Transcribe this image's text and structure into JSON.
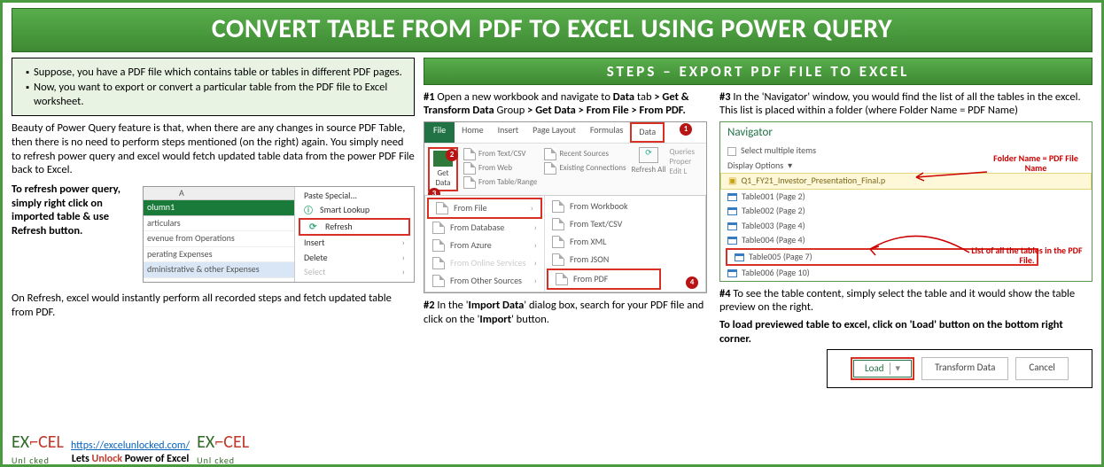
{
  "title": "CONVERT TABLE FROM PDF TO EXCEL USING POWER QUERY",
  "steps_header": "STEPS – EXPORT PDF FILE TO EXCEL",
  "intro_bullets": [
    "Suppose, you have a PDF file which contains table or tables in different PDF pages.",
    "Now, you want to export or convert a particular table from the PDF file to Excel worksheet."
  ],
  "beauty_para": "Beauty of Power Query feature is that, when there are any changes in source PDF Table, then there is no need to perform steps mentioned (on the right) again. You simply need to refresh power query and excel would fetch updated table data from the power PDF File back to Excel.",
  "refresh_hint": "To refresh power query, simply right click on imported table & use Refresh button.",
  "on_refresh": "On Refresh, excel would instantly perform all recorded steps and fetch updated table from PDF.",
  "footer": {
    "url": "https://excelunlocked.com/",
    "tag_pre": "Lets ",
    "tag_unlock": "Unlock",
    "tag_post": " Power of Excel",
    "logo_ex": "EX",
    "logo_cel": "CEL",
    "logo_sub": "Unl    cked"
  },
  "mini_excel": {
    "col_letter": "A",
    "header": "olumn1",
    "rows": [
      "articulars",
      "evenue from Operations",
      "perating Expenses",
      "dministrative & other Expenses"
    ],
    "ctx": {
      "paste": "Paste Special...",
      "lookup": "Smart Lookup",
      "refresh": "Refresh",
      "insert": "Insert",
      "delete": "Delete",
      "select": "Select"
    }
  },
  "step1": {
    "num": "#1",
    "text_a": " Open a new workbook and navigate to ",
    "b1": "Data",
    "text_b": " tab ",
    "b2": "> Get & Transform Data",
    "text_c": " Group ",
    "b3": "> Get Data > From File > From PDF."
  },
  "ribbon": {
    "file": "File",
    "tabs": [
      "Home",
      "Insert",
      "Page Layout",
      "Formulas",
      "Data"
    ],
    "getdata": "Get Data",
    "btns_l": [
      "From Text/CSV",
      "From Web",
      "From Table/Range"
    ],
    "btns_r": [
      "Recent Sources",
      "Existing Connections"
    ],
    "refresh": "Refresh All",
    "queries": "Queries",
    "edit": "Edit L",
    "prop": "Proper",
    "menu_left": [
      "From File",
      "From Database",
      "From Azure",
      "From Online Services",
      "From Other Sources"
    ],
    "menu_right": [
      "From Workbook",
      "From Text/CSV",
      "From XML",
      "From JSON",
      "From PDF"
    ],
    "badges": [
      "1",
      "2",
      "3",
      "4"
    ]
  },
  "step2": {
    "num": "#2",
    "a": " In the '",
    "b1": "Import Data",
    "b": "' dialog box, search for your PDF file and click on the '",
    "b2": "Import",
    "c": "' button."
  },
  "step3": {
    "num": "#3",
    "text": " In the 'Navigator' window, you would find the list of all the tables in the excel. This list is placed within a folder (where Folder Name = PDF Name)"
  },
  "nav": {
    "title": "Navigator",
    "multi": "Select multiple items",
    "disp": "Display Options",
    "folder": "Q1_FY21_Investor_Presentation_Final.p",
    "items": [
      "Table001 (Page 2)",
      "Table002 (Page 2)",
      "Table003 (Page 4)",
      "Table004 (Page 4)",
      "Table005 (Page 7)",
      "Table006 (Page 10)"
    ],
    "annot1": "Folder Name = PDF File Name",
    "annot2": "List of all the tables in the PDF File."
  },
  "step4": {
    "num": "#4",
    "text": " To see the table content, simply select the table and it would show the table preview on the right.",
    "bold": "To load previewed table to excel, click on 'Load' button on the bottom right corner."
  },
  "load_bar": {
    "load": "Load",
    "transform": "Transform Data",
    "cancel": "Cancel"
  }
}
